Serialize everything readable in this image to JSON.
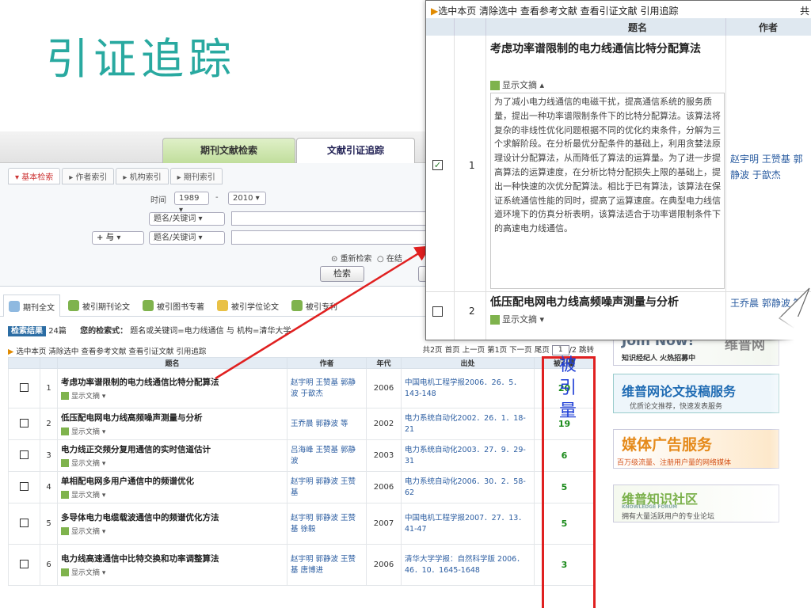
{
  "slide_title": "引证追踪",
  "top_tabs": [
    "期刊文献检索",
    "文献引证追踪"
  ],
  "search": {
    "subtabs": [
      "基本检索",
      "作者索引",
      "机构索引",
      "期刊索引"
    ],
    "time_label": "时间",
    "year_from": "1989",
    "year_dash": "-",
    "year_to": "2010",
    "field1": "题名/关键词",
    "logic": "+ 与",
    "field2": "题名/关键词",
    "radio1": "重新检索",
    "radio2": "在结",
    "search_button": "检索"
  },
  "result_tabs": [
    "期刊全文",
    "被引期刊论文",
    "被引图书专著",
    "被引学位论文",
    "被引专利"
  ],
  "summary": {
    "tag": "检索结果",
    "count": "24篇",
    "cond_label": "您的检索式：",
    "cond": "题名或关键词=电力线通信 与 机构=清华大学"
  },
  "toolbar": {
    "left": "选中本页 清除选中 查看参考文献 查看引证文献 引用追踪",
    "right_pre": "共2页 首页 上一页 第1页 下一页 尾页",
    "page_input": "1",
    "right_post": "/2 跳转"
  },
  "columns": [
    "题名",
    "作者",
    "年代",
    "出处",
    "被引量"
  ],
  "rows": [
    {
      "no": "1",
      "title": "考虑功率谱限制的电力线通信比特分配算法",
      "show": "显示文摘",
      "authors": "赵宇明 王赞基 郭静波 于歆杰",
      "year": "2006",
      "source": "中国电机工程学报2006．26．5．143-148",
      "cites": "20"
    },
    {
      "no": "2",
      "title": "低压配电网电力线高频噪声测量与分析",
      "show": "显示文摘",
      "authors": "王乔晨 郭静波 等",
      "year": "2002",
      "source": "电力系统自动化2002．26．1．18-21",
      "cites": "19"
    },
    {
      "no": "3",
      "title": "电力线正交频分复用通信的实时信道估计",
      "show": "显示文摘",
      "authors": "吕海峰 王赞基 郭静波",
      "year": "2003",
      "source": "电力系统自动化2003．27．9．29-31",
      "cites": "6"
    },
    {
      "no": "4",
      "title": "单相配电网多用户通信中的频谱优化",
      "show": "显示文摘",
      "authors": "赵宇明 郭静波 王赞基",
      "year": "2006",
      "source": "电力系统自动化2006．30．2．58-62",
      "cites": "5"
    },
    {
      "no": "5",
      "title": "多导体电力电缆载波通信中的频谱优化方法",
      "show": "显示文摘",
      "authors": "赵宇明 郭静波 王赞基 徐毅",
      "year": "2007",
      "source": "中国电机工程学报2007．27．13．41-47",
      "cites": "5"
    },
    {
      "no": "6",
      "title": "电力线高速通信中比特交换和功率调整算法",
      "show": "显示文摘",
      "authors": "赵宇明 郭静波 王赞基 唐博进",
      "year": "2006",
      "source": "清华大学学报：自然科学版 2006．46．10．1645-1648",
      "cites": "3"
    }
  ],
  "annotation": "被引量",
  "banners": [
    {
      "main": "Join Now!",
      "sub": "知识经纪人 火热招募中",
      "side": "维普网"
    },
    {
      "main": "维普网论文投稿服务",
      "sub": "优质论文推荐，快速发表服务"
    },
    {
      "main": "媒体广告服务",
      "sub": "百万级流量、注册用户量的网络媒体"
    },
    {
      "main": "维普知识社区",
      "sub": "拥有大量活跃用户的专业论坛",
      "small": "KNOWLEDGE FORUM"
    }
  ],
  "zoom": {
    "toolbar": "选中本页 清除选中 查看参考文献 查看引证文献 引用追踪",
    "toolbar_right": "共",
    "head_title": "题名",
    "head_author": "作者",
    "row1": {
      "no": "1",
      "title": "考虑功率谱限制的电力线通信比特分配算法",
      "show": "显示文摘",
      "abstract": "为了减小电力线通信的电磁干扰，提高通信系统的服务质量，提出一种功率谱限制条件下的比特分配算法。该算法将复杂的非线性优化问题根据不同的优化约束条件，分解为三个求解阶段。在分析最优分配条件的基础上，利用贪婪法原理设计分配算法，从而降低了算法的运算量。为了进一步提高算法的运算速度，在分析比特分配损失上限的基础上，提出一种快速的次优分配算法。相比于已有算法，该算法在保证系统通信性能的同时，提高了运算速度。在典型电力线信道环境下的仿真分析表明，该算法适合于功率谱限制条件下的高速电力线通信。",
      "authors": "赵宇明 王赞基 郭静波 于歆杰"
    },
    "row2": {
      "no": "2",
      "title": "低压配电网电力线高频噪声测量与分析",
      "show": "显示文摘",
      "authors": "王乔晨 郭静波 等"
    }
  }
}
